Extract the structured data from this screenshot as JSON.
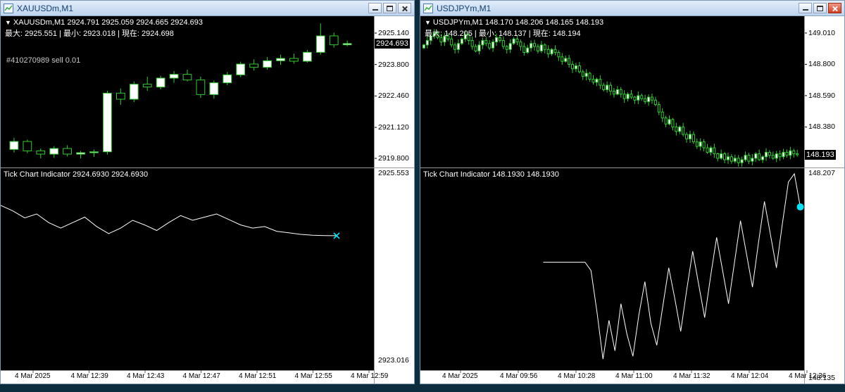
{
  "windows": [
    {
      "title": "XAUUSDm,M1",
      "symbol_marker": "▼",
      "info_line": "XAUUSDm,M1 2924.791 2925.059 2924.665 2924.693",
      "stats_line": "最大: 2925.551 | 最小: 2923.018 | 現在: 2924.698",
      "order_label": "#410270989 sell 0.01",
      "tick_label": "Tick Chart Indicator 2924.6930 2924.6930",
      "price_tag": "2924.693",
      "time_labels": [
        "4 Mar 2025",
        "4 Mar 12:39",
        "4 Mar 12:43",
        "4 Mar 12:47",
        "4 Mar 12:51",
        "4 Mar 12:55",
        "4 Mar 12:59"
      ],
      "chart_data": {
        "type": "candlestick",
        "main": {
          "scale_top": 2925.86,
          "scale_bottom": 2919.41,
          "axis_labels": [
            "2925.140",
            "2923.800",
            "2922.460",
            "2921.120",
            "2919.800"
          ],
          "current_price": 2924.693,
          "candles": [
            [
              2920.18,
              2920.68,
              2920.05,
              2920.52
            ],
            [
              2920.52,
              2920.6,
              2920.02,
              2920.12
            ],
            [
              2920.12,
              2920.22,
              2919.8,
              2919.98
            ],
            [
              2919.98,
              2920.32,
              2919.82,
              2920.22
            ],
            [
              2920.22,
              2920.36,
              2919.88,
              2919.98
            ],
            [
              2919.98,
              2920.12,
              2919.8,
              2920.04
            ],
            [
              2920.04,
              2920.18,
              2919.86,
              2920.08
            ],
            [
              2920.08,
              2922.68,
              2919.96,
              2922.58
            ],
            [
              2922.58,
              2922.78,
              2922.08,
              2922.32
            ],
            [
              2922.32,
              2923.08,
              2922.2,
              2922.96
            ],
            [
              2922.96,
              2923.28,
              2922.68,
              2922.84
            ],
            [
              2922.84,
              2923.32,
              2922.74,
              2923.22
            ],
            [
              2923.22,
              2923.52,
              2923.02,
              2923.38
            ],
            [
              2923.38,
              2923.58,
              2923.08,
              2923.14
            ],
            [
              2923.14,
              2923.28,
              2922.38,
              2922.52
            ],
            [
              2922.52,
              2923.12,
              2922.34,
              2923.02
            ],
            [
              2923.02,
              2923.48,
              2922.92,
              2923.36
            ],
            [
              2923.36,
              2923.92,
              2923.26,
              2923.82
            ],
            [
              2923.82,
              2924.02,
              2923.54,
              2923.68
            ],
            [
              2923.68,
              2924.12,
              2923.58,
              2923.96
            ],
            [
              2923.96,
              2924.22,
              2923.78,
              2924.06
            ],
            [
              2924.06,
              2924.26,
              2923.84,
              2923.94
            ],
            [
              2923.94,
              2924.42,
              2923.88,
              2924.32
            ],
            [
              2924.32,
              2925.55,
              2924.22,
              2925.02
            ],
            [
              2925.02,
              2925.16,
              2924.52,
              2924.64
            ],
            [
              2924.64,
              2924.82,
              2924.58,
              2924.693
            ]
          ]
        },
        "tick": {
          "type": "line",
          "scale_top": 2925.553,
          "scale_bottom": 2923.016,
          "top_label": "2925.553",
          "bottom_label": "2923.016",
          "start_frac": 0.0,
          "end_frac": 0.9,
          "marker": "x",
          "marker_color": "#00e5ff",
          "values": [
            2925.08,
            2925.01,
            2924.92,
            2924.97,
            2924.86,
            2924.79,
            2924.86,
            2924.93,
            2924.81,
            2924.72,
            2924.79,
            2924.89,
            2924.83,
            2924.76,
            2924.86,
            2924.95,
            2924.89,
            2924.93,
            2924.97,
            2924.9,
            2924.83,
            2924.79,
            2924.81,
            2924.75,
            2924.73,
            2924.71,
            2924.7,
            2924.695,
            2924.693
          ]
        }
      }
    },
    {
      "title": "USDJPYm,M1",
      "symbol_marker": "▼",
      "info_line": "USDJPYm,M1 148.170 148.206 148.165 148.193",
      "stats_line": "最大: 148.205 | 最小: 148.137 | 現在: 148.194",
      "tick_label": "Tick Chart Indicator 148.1930 148.1930",
      "price_tag": "148.193",
      "time_labels": [
        "4 Mar 2025",
        "4 Mar 09:56",
        "4 Mar 10:28",
        "4 Mar 11:00",
        "4 Mar 11:32",
        "4 Mar 12:04",
        "4 Mar 12:36"
      ],
      "chart_data": {
        "type": "candlestick",
        "main": {
          "scale_top": 149.123,
          "scale_bottom": 148.108,
          "axis_labels": [
            "149.010",
            "148.800",
            "148.590",
            "148.380"
          ],
          "current_price": 148.193,
          "closes": [
            148.93,
            148.96,
            148.99,
            149.01,
            148.98,
            148.95,
            148.99,
            148.97,
            148.93,
            148.9,
            148.94,
            148.97,
            149.0,
            148.96,
            148.92,
            148.89,
            148.93,
            148.96,
            148.94,
            148.91,
            148.95,
            148.98,
            148.96,
            148.92,
            148.9,
            148.94,
            148.97,
            148.95,
            148.92,
            148.88,
            148.91,
            148.94,
            148.92,
            148.89,
            148.93,
            148.9,
            148.87,
            148.9,
            148.88,
            148.85,
            148.82,
            148.84,
            148.8,
            148.77,
            148.79,
            148.75,
            148.72,
            148.74,
            148.7,
            148.68,
            148.7,
            148.66,
            148.63,
            148.66,
            148.62,
            148.6,
            148.63,
            148.6,
            148.57,
            148.6,
            148.58,
            148.56,
            148.59,
            148.57,
            148.55,
            148.58,
            148.56,
            148.53,
            148.48,
            148.44,
            148.4,
            148.43,
            148.38,
            148.35,
            148.38,
            148.33,
            148.3,
            148.33,
            148.28,
            148.25,
            148.28,
            148.24,
            148.21,
            148.24,
            148.2,
            148.17,
            148.2,
            148.16,
            148.18,
            148.15,
            148.17,
            148.14,
            148.16,
            148.19,
            148.15,
            148.17,
            148.2,
            148.16,
            148.18,
            148.21,
            148.19,
            148.17,
            148.2,
            148.18,
            148.21,
            148.19,
            148.22,
            148.2,
            148.193
          ]
        },
        "tick": {
          "type": "line",
          "scale_top": 148.207,
          "scale_bottom": 148.135,
          "top_label": "148.207",
          "bottom_label": "148.135",
          "start_frac": 0.32,
          "end_frac": 0.99,
          "marker": "dot",
          "marker_color": "#00e5ff",
          "values": [
            148.173,
            148.173,
            148.173,
            148.173,
            148.173,
            148.173,
            148.173,
            148.173,
            148.17,
            148.155,
            148.138,
            148.152,
            148.141,
            148.158,
            148.147,
            148.139,
            148.154,
            148.166,
            148.151,
            148.143,
            148.157,
            148.171,
            148.16,
            148.148,
            148.163,
            148.177,
            148.165,
            148.153,
            148.168,
            148.182,
            148.17,
            148.158,
            148.173,
            148.188,
            148.176,
            148.164,
            148.18,
            148.195,
            148.183,
            148.171,
            148.187,
            148.202,
            148.205,
            148.193
          ]
        }
      }
    }
  ],
  "colors": {
    "candle_stroke": "#32cd32",
    "bull_fill": "#ffffff",
    "bear_fill": "#000000",
    "tick_line": "#ffffff",
    "chart_bg": "#000000",
    "axis_bg": "#ffffff",
    "mdi_bg": "#0b2d3d"
  }
}
